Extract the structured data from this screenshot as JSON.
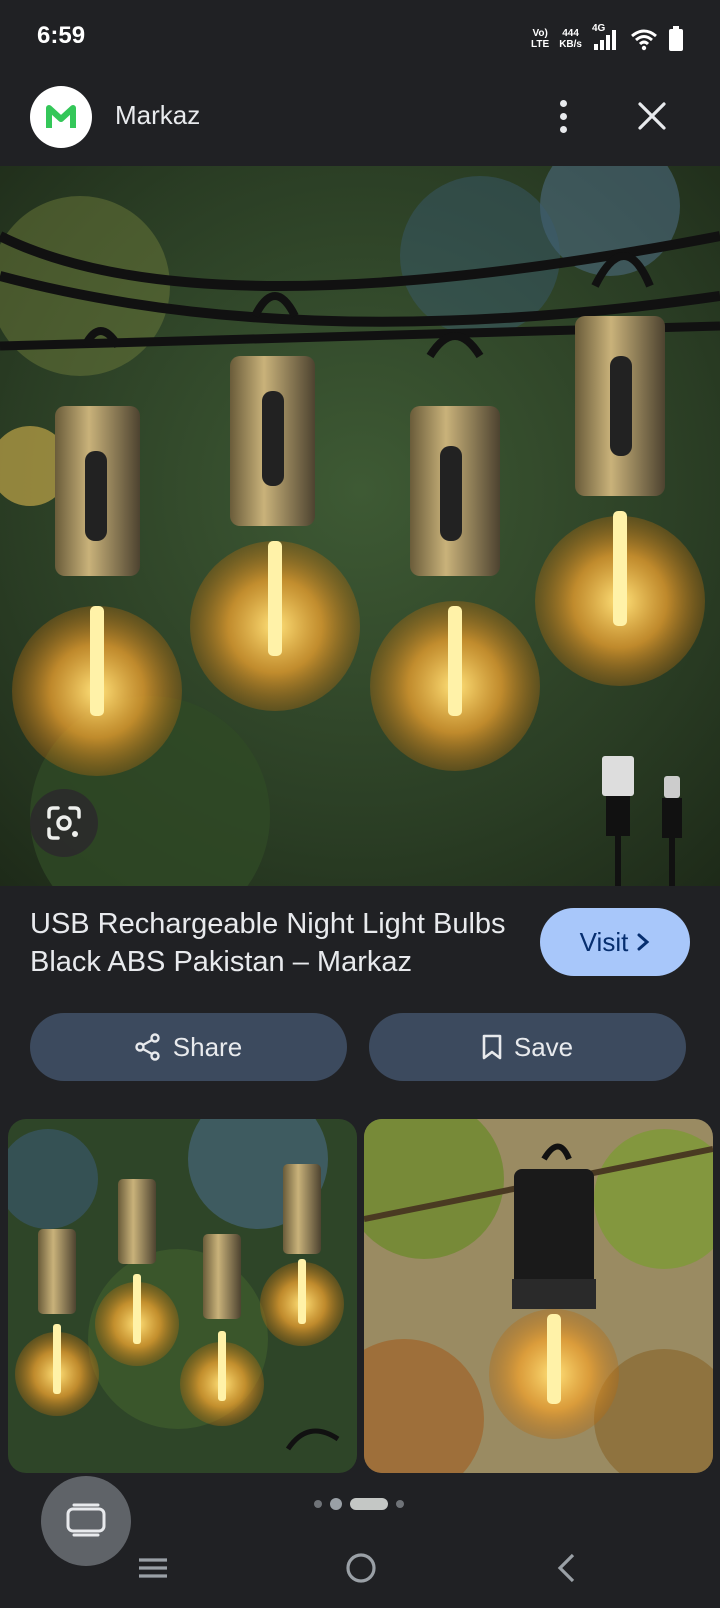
{
  "status_bar": {
    "time": "6:59",
    "volte_top": "Vo)",
    "volte_bottom": "LTE",
    "speed_top": "444",
    "speed_bottom": "KB/s",
    "network": "4G"
  },
  "header": {
    "app_name": "Markaz",
    "logo_letter": "M"
  },
  "result": {
    "title": "USB Rechargeable Night Light Bulbs Black ABS Pakistan – Markaz",
    "visit_label": "Visit"
  },
  "actions": {
    "share_label": "Share",
    "save_label": "Save"
  },
  "pager": {
    "count": 4,
    "active_index": 2
  },
  "colors": {
    "background": "#202124",
    "accent": "#a8c7fa",
    "pill": "#3c4a5e",
    "brand_green": "#34c759"
  },
  "icons": [
    "three-dot-menu-icon",
    "close-icon",
    "google-lens-icon",
    "chevron-right-icon",
    "share-icon",
    "bookmark-icon",
    "pip-icon",
    "nav-menu-icon",
    "nav-home-icon",
    "nav-back-icon"
  ]
}
